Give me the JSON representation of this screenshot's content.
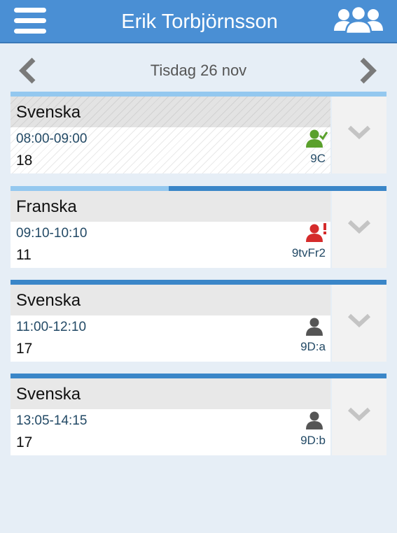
{
  "header": {
    "title": "Erik Torbjörnsson",
    "menu_icon": "hamburger-menu-icon",
    "groups_icon": "users-group-icon",
    "background_color": "#4a8fd4"
  },
  "date_nav": {
    "label": "Tisdag 26 nov",
    "prev_icon": "chevron-left-icon",
    "next_icon": "chevron-right-icon"
  },
  "lessons": [
    {
      "subject": "Svenska",
      "time": "08:00-09:00",
      "room": "18",
      "group": "9C",
      "attendance": "registered",
      "attendance_icon": "user-check-icon",
      "attendance_color": "#5aa02c",
      "state": "past",
      "progress": 1.0
    },
    {
      "subject": "Franska",
      "time": "09:10-10:10",
      "room": "11",
      "group": "9tvFr2",
      "attendance": "not-registered",
      "attendance_icon": "user-alert-icon",
      "attendance_color": "#d52b2b",
      "state": "ongoing",
      "progress": 0.42
    },
    {
      "subject": "Svenska",
      "time": "11:00-12:10",
      "room": "17",
      "group": "9D:a",
      "attendance": "upcoming",
      "attendance_icon": "user-icon",
      "attendance_color": "#555555",
      "state": "upcoming",
      "progress": 0
    },
    {
      "subject": "Svenska",
      "time": "13:05-14:15",
      "room": "17",
      "group": "9D:b",
      "attendance": "upcoming",
      "attendance_icon": "user-icon",
      "attendance_color": "#555555",
      "state": "upcoming",
      "progress": 0
    }
  ],
  "colors": {
    "progress_done": "#94c8ef",
    "progress_remaining": "#3a86c8",
    "chevron": "#c4c4c4"
  }
}
